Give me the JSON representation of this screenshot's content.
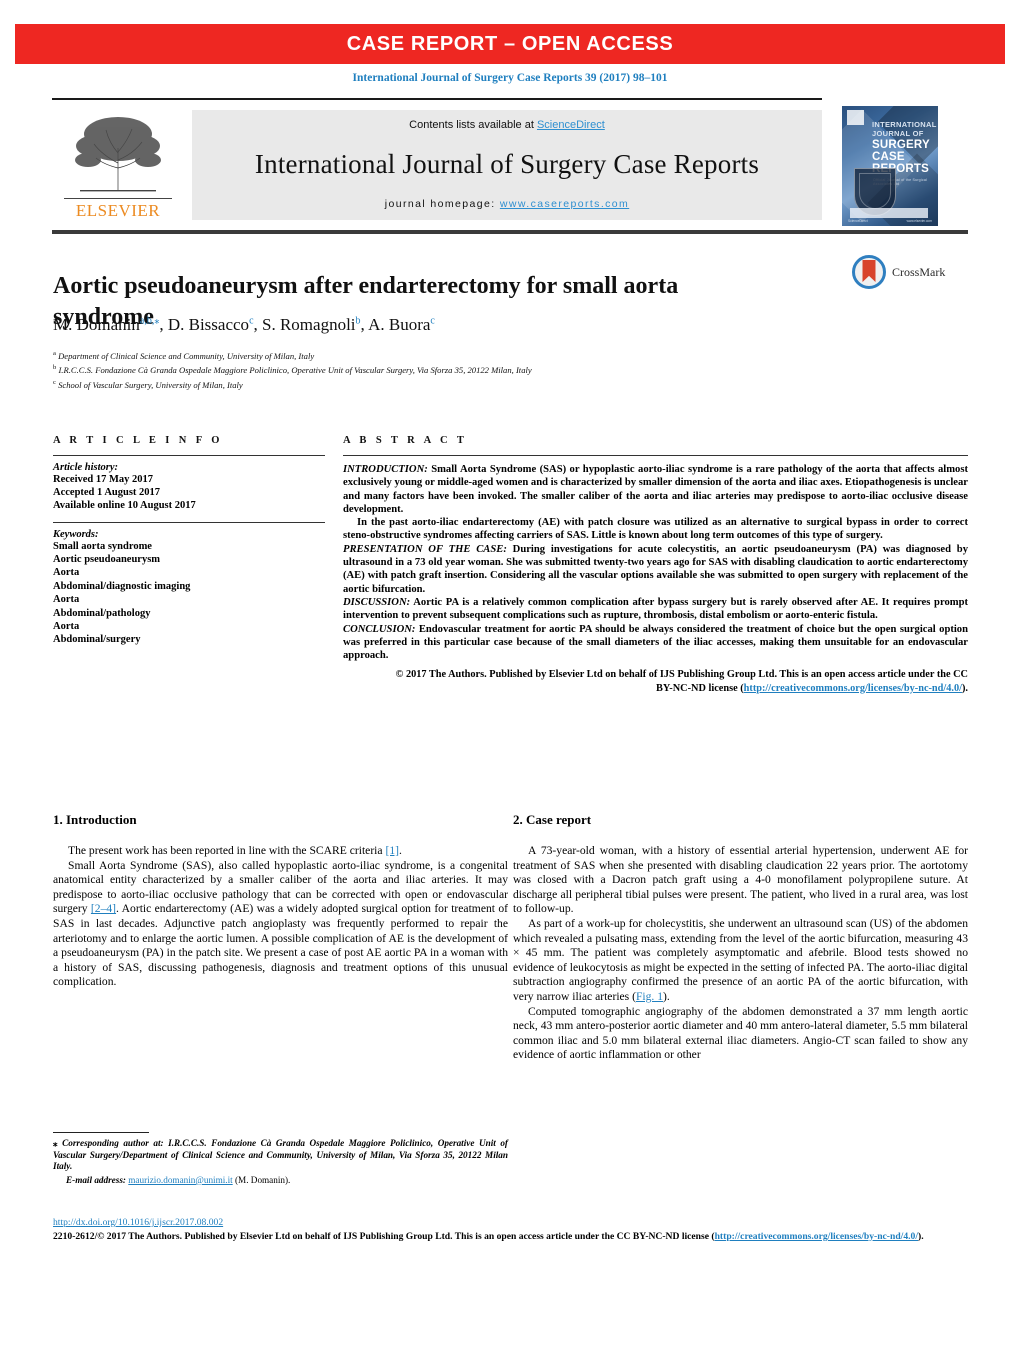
{
  "banner": {
    "text": "CASE REPORT – OPEN ACCESS",
    "color": "#ee2722"
  },
  "citation": "International Journal of Surgery Case Reports 39 (2017) 98–101",
  "journal_header": {
    "contents_prefix": "Contents lists available at ",
    "contents_link": "ScienceDirect",
    "journal_title": "International Journal of Surgery Case Reports",
    "homepage_prefix": "journal homepage: ",
    "homepage_url": "www.casereports.com",
    "publisher": "ELSEVIER",
    "cover": {
      "line1": "INTERNATIONAL",
      "line2": "JOURNAL OF",
      "line3": "SURGERY",
      "line4": "CASE",
      "line5": "REPORTS",
      "subtitle": "Official Journal of the Surgical Associates Ltd",
      "foot_left": "ScienceDirect",
      "foot_right": "www.elsevier.com"
    }
  },
  "article": {
    "title": "Aortic pseudoaneurysm after endarterectomy for small aorta syndrome",
    "crossmark_label": "CrossMark",
    "authors_html": "M. Domanin<sup>a,b,⁎</sup>, D. Bissacco<sup>c</sup>, S. Romagnoli<sup>b</sup>, A. Buora<sup>c</sup>",
    "affiliations": [
      {
        "marker": "a",
        "text": "Department of Clinical Science and Community, University of Milan, Italy"
      },
      {
        "marker": "b",
        "text": "I.R.C.C.S. Fondazione Cà Granda Ospedale Maggiore Policlinico, Operative Unit of Vascular Surgery, Via Sforza 35, 20122 Milan, Italy"
      },
      {
        "marker": "c",
        "text": "School of Vascular Surgery, University of Milan, Italy"
      }
    ]
  },
  "article_info": {
    "heading": "A R T I C L E   I N F O",
    "history_label": "Article history:",
    "history": [
      "Received 17 May 2017",
      "Accepted 1 August 2017",
      "Available online 10 August 2017"
    ],
    "keywords_label": "Keywords:",
    "keywords": [
      "Small aorta syndrome",
      "Aortic pseudoaneurysm",
      "Aorta",
      "Abdominal/diagnostic imaging",
      "Aorta",
      "Abdominal/pathology",
      "Aorta",
      "Abdominal/surgery"
    ]
  },
  "abstract": {
    "heading": "A B S T R A C T",
    "p1_lead": "INTRODUCTION:",
    "p1": " Small Aorta Syndrome (SAS) or hypoplastic aorto-iliac syndrome is a rare pathology of the aorta that affects almost exclusively young or middle-aged women and is characterized by smaller dimension of the aorta and iliac axes. Etiopathogenesis is unclear and many factors have been invoked. The smaller caliber of the aorta and iliac arteries may predispose to aorto-iliac occlusive disease development.",
    "p2": "In the past aorto-iliac endarterectomy (AE) with patch closure was utilized as an alternative to surgical bypass in order to correct steno-obstructive syndromes affecting carriers of SAS. Little is known about long term outcomes of this type of surgery.",
    "p3_lead": "PRESENTATION OF THE CASE:",
    "p3": " During investigations for acute colecystitis, an aortic pseudoaneurysm (PA) was diagnosed by ultrasound in a 73 old year woman. She was submitted twenty-two years ago for SAS with disabling claudication to aortic endarterectomy (AE) with patch graft insertion. Considering all the vascular options available she was submitted to open surgery with replacement of the aortic bifurcation.",
    "p4_lead": "DISCUSSION:",
    "p4": " Aortic PA is a relatively common complication after bypass surgery but is rarely observed after AE. It requires prompt intervention to prevent subsequent complications such as rupture, thrombosis, distal embolism or aorto-enteric fistula.",
    "p5_lead": "CONCLUSION:",
    "p5": " Endovascular treatment for aortic PA should be always considered the treatment of choice but the open surgical option was preferred in this particular case because of the small diameters of the iliac accesses, making them unsuitable for an endovascular approach.",
    "copyright_pre": "© 2017 The Authors. Published by Elsevier Ltd on behalf of IJS Publishing Group Ltd. This is an open access article under the CC BY-NC-ND license (",
    "copyright_link": "http://creativecommons.org/licenses/by-nc-nd/4.0/",
    "copyright_post": ")."
  },
  "body": {
    "section1_heading": "1.  Introduction",
    "s1_p1_a": "The present work has been reported in line with the SCARE criteria ",
    "s1_p1_ref": "[1]",
    "s1_p1_b": ".",
    "s1_p2_a": "Small Aorta Syndrome (SAS), also called hypoplastic aorto-iliac syndrome, is a congenital anatomical entity characterized by a smaller caliber of the aorta and iliac arteries. It may predispose to aorto-iliac occlusive pathology that can be corrected with open or endovascular surgery ",
    "s1_p2_ref": "[2–4]",
    "s1_p2_b": ". Aortic endarterectomy (AE) was a widely adopted surgical option for treatment of SAS in last decades. Adjunctive patch angioplasty was frequently performed to repair the arteriotomy and to enlarge the aortic lumen. A possible complication of AE is the development of a pseudoaneurysm (PA) in the patch site. We present a case of post AE aortic PA in a woman with a history of SAS, discussing pathogenesis, diagnosis and treatment options of this unusual complication.",
    "section2_heading": "2.  Case report",
    "s2_p1": "A 73-year-old woman, with a history of essential arterial hypertension, underwent AE for treatment of SAS when she presented with disabling claudication 22 years prior. The aortotomy was closed with a Dacron patch graft using a 4-0 monofilament polypropilene suture. At discharge all peripheral tibial pulses were present. The patient, who lived in a rural area, was lost to follow-up.",
    "s2_p2_a": "As part of a work-up for cholecystitis, she underwent an ultrasound scan (US) of the abdomen which revealed a pulsating mass, extending from the level of the aortic bifurcation, measuring 43 × 45 mm. The patient was completely asymptomatic and afebrile. Blood tests showed no evidence of leukocytosis as might be expected in the setting of infected PA. The aorto-iliac digital subtraction angiography confirmed the presence of an aortic PA of the aortic bifurcation, with very narrow iliac arteries (",
    "s2_p2_ref": "Fig. 1",
    "s2_p2_b": ").",
    "s2_p3": "Computed tomographic angiography of the abdomen demonstrated a 37 mm length aortic neck, 43 mm antero-posterior aortic diameter and 40 mm antero-lateral diameter, 5.5 mm bilateral common iliac and 5.0 mm bilateral external iliac diameters. Angio-CT scan failed to show any evidence of aortic inflammation or other"
  },
  "footnote": {
    "marker": "⁎",
    "corresponding": "Corresponding author at: I.R.C.C.S. Fondazione Cà Granda Ospedale Maggiore Policlinico, Operative Unit of Vascular Surgery/Department of Clinical Science and Community, University of Milan, Via Sforza 35, 20122 Milan Italy.",
    "email_label": "E-mail address:",
    "email": "maurizio.domanin@unimi.it",
    "email_owner": "(M. Domanin)."
  },
  "footer": {
    "doi": "http://dx.doi.org/10.1016/j.ijscr.2017.08.002",
    "issn_copy": "2210-2612/© 2017 The Authors. Published by Elsevier Ltd on behalf of IJS Publishing Group Ltd. This is an open access article under the CC BY-NC-ND license (",
    "license_link": "http://creativecommons.org/licenses/by-nc-nd/4.0/",
    "copy_post": ")."
  },
  "colors": {
    "accent_red": "#ee2722",
    "link_blue": "#1f7fbf",
    "elsevier_orange": "#ec8b22"
  }
}
